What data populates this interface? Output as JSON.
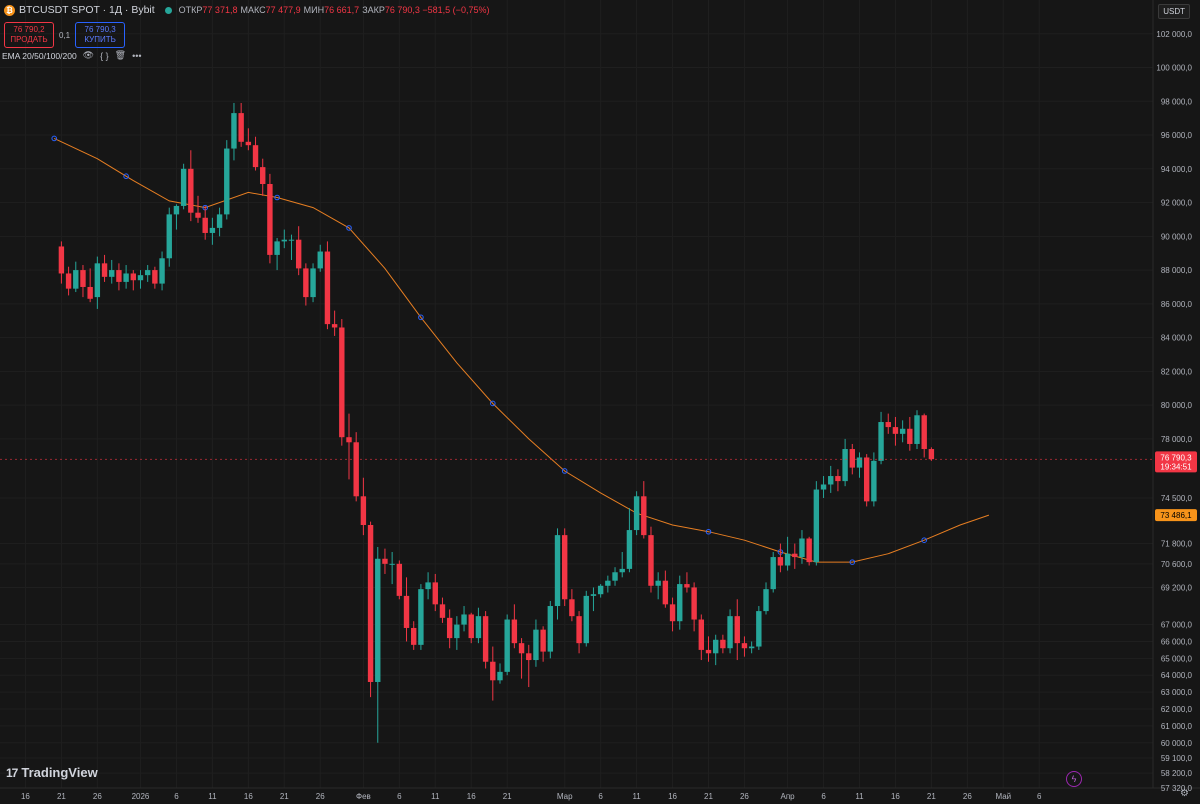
{
  "header": {
    "coin_glyph": "₿",
    "symbol": "BTCUSDT SPOT · 1Д · Bybit",
    "open_label": "ОТКР",
    "open_value": "77 371,8",
    "high_label": "МАКС",
    "high_value": "77 477,9",
    "low_label": "МИН",
    "low_value": "76 661,7",
    "close_label": "ЗАКР",
    "close_value": "76 790,3 −581,5 (−0,75%)"
  },
  "trade": {
    "sell_price": "76 790,2",
    "sell_label": "ПРОДАТЬ",
    "qty": "0,1",
    "buy_price": "76 790,3",
    "buy_label": "КУПИТЬ"
  },
  "indicator": {
    "label": "EMA 20/50/100/200",
    "eye_icon": "👁",
    "code_icon": "{ }",
    "trash_icon": "🗑",
    "more_icon": "•••"
  },
  "currency": "USDT",
  "brand": "TradingView",
  "brand_mark": "17",
  "colors": {
    "bg": "#161616",
    "up": "#26a69a",
    "down": "#f23645",
    "ema": "#e67e22",
    "ema_marker": "#2962ff",
    "price_tag": "#f23645",
    "ema_tag": "#f7931a"
  },
  "chart_data": {
    "type": "candlestick",
    "ylim": [
      57320,
      104000
    ],
    "y_ticks": [
      {
        "v": 102000,
        "t": "102 000,0"
      },
      {
        "v": 100000,
        "t": "100 000,0"
      },
      {
        "v": 98000,
        "t": "98 000,0"
      },
      {
        "v": 96000,
        "t": "96 000,0"
      },
      {
        "v": 94000,
        "t": "94 000,0"
      },
      {
        "v": 92000,
        "t": "92 000,0"
      },
      {
        "v": 90000,
        "t": "90 000,0"
      },
      {
        "v": 88000,
        "t": "88 000,0"
      },
      {
        "v": 86000,
        "t": "86 000,0"
      },
      {
        "v": 84000,
        "t": "84 000,0"
      },
      {
        "v": 82000,
        "t": "82 000,0"
      },
      {
        "v": 80000,
        "t": "80 000,0"
      },
      {
        "v": 78000,
        "t": "78 000,0"
      },
      {
        "v": 74500,
        "t": "74 500,0"
      },
      {
        "v": 71800,
        "t": "71 800,0"
      },
      {
        "v": 70600,
        "t": "70 600,0"
      },
      {
        "v": 69200,
        "t": "69 200,0"
      },
      {
        "v": 67000,
        "t": "67 000,0"
      },
      {
        "v": 66000,
        "t": "66 000,0"
      },
      {
        "v": 65000,
        "t": "65 000,0"
      },
      {
        "v": 64000,
        "t": "64 000,0"
      },
      {
        "v": 63000,
        "t": "63 000,0"
      },
      {
        "v": 62000,
        "t": "62 000,0"
      },
      {
        "v": 61000,
        "t": "61 000,0"
      },
      {
        "v": 60000,
        "t": "60 000,0"
      },
      {
        "v": 59100,
        "t": "59 100,0"
      },
      {
        "v": 58200,
        "t": "58 200,0"
      },
      {
        "v": 57320,
        "t": "57 320,0"
      }
    ],
    "x_ticks": [
      {
        "i": -5,
        "t": "16"
      },
      {
        "i": 0,
        "t": "21"
      },
      {
        "i": 5,
        "t": "26"
      },
      {
        "i": 11,
        "t": "2026"
      },
      {
        "i": 16,
        "t": "6"
      },
      {
        "i": 21,
        "t": "11"
      },
      {
        "i": 26,
        "t": "16"
      },
      {
        "i": 31,
        "t": "21"
      },
      {
        "i": 36,
        "t": "26"
      },
      {
        "i": 42,
        "t": "Фев"
      },
      {
        "i": 47,
        "t": "6"
      },
      {
        "i": 52,
        "t": "11"
      },
      {
        "i": 57,
        "t": "16"
      },
      {
        "i": 62,
        "t": "21"
      },
      {
        "i": 70,
        "t": "Мар"
      },
      {
        "i": 75,
        "t": "6"
      },
      {
        "i": 80,
        "t": "11"
      },
      {
        "i": 85,
        "t": "16"
      },
      {
        "i": 90,
        "t": "21"
      },
      {
        "i": 95,
        "t": "26"
      },
      {
        "i": 101,
        "t": "Апр"
      },
      {
        "i": 106,
        "t": "6"
      },
      {
        "i": 111,
        "t": "11"
      },
      {
        "i": 116,
        "t": "16"
      },
      {
        "i": 121,
        "t": "21"
      },
      {
        "i": 126,
        "t": "26"
      },
      {
        "i": 131,
        "t": "Май"
      },
      {
        "i": 136,
        "t": "6"
      }
    ],
    "last_price": {
      "value": 76790.3,
      "label": "76 790,3",
      "timer": "19:34:51"
    },
    "ema_tag": {
      "value": 73486.1,
      "label": "73 486,1"
    },
    "ema": [
      {
        "i": -1,
        "v": 95800
      },
      {
        "i": 5,
        "v": 94600
      },
      {
        "i": 10,
        "v": 93300
      },
      {
        "i": 15,
        "v": 92100
      },
      {
        "i": 20,
        "v": 91700
      },
      {
        "i": 26,
        "v": 92600
      },
      {
        "i": 30,
        "v": 92300
      },
      {
        "i": 35,
        "v": 91700
      },
      {
        "i": 40,
        "v": 90500
      },
      {
        "i": 45,
        "v": 88100
      },
      {
        "i": 50,
        "v": 85200
      },
      {
        "i": 55,
        "v": 82500
      },
      {
        "i": 60,
        "v": 80100
      },
      {
        "i": 65,
        "v": 78000
      },
      {
        "i": 70,
        "v": 76100
      },
      {
        "i": 75,
        "v": 74800
      },
      {
        "i": 80,
        "v": 73600
      },
      {
        "i": 85,
        "v": 72900
      },
      {
        "i": 90,
        "v": 72500
      },
      {
        "i": 95,
        "v": 72000
      },
      {
        "i": 100,
        "v": 71300
      },
      {
        "i": 105,
        "v": 70700
      },
      {
        "i": 110,
        "v": 70700
      },
      {
        "i": 115,
        "v": 71200
      },
      {
        "i": 120,
        "v": 72000
      },
      {
        "i": 125,
        "v": 72900
      },
      {
        "i": 129,
        "v": 73486
      }
    ],
    "ema_markers": [
      -1,
      9,
      20,
      30,
      40,
      50,
      60,
      70,
      80,
      90,
      100,
      110,
      120
    ],
    "candles": [
      [
        89400,
        89700,
        87200,
        87800
      ],
      [
        87800,
        88200,
        86500,
        86900
      ],
      [
        86900,
        88500,
        86700,
        88000
      ],
      [
        88000,
        88300,
        86400,
        87000
      ],
      [
        87000,
        88100,
        86100,
        86300
      ],
      [
        86400,
        88800,
        85700,
        88400
      ],
      [
        88400,
        88900,
        87300,
        87600
      ],
      [
        87600,
        88600,
        87200,
        88000
      ],
      [
        88000,
        88400,
        86800,
        87300
      ],
      [
        87300,
        88300,
        86900,
        87800
      ],
      [
        87800,
        88000,
        86800,
        87400
      ],
      [
        87400,
        88000,
        86900,
        87700
      ],
      [
        87700,
        88300,
        87300,
        88000
      ],
      [
        88000,
        88200,
        86900,
        87200
      ],
      [
        87200,
        89100,
        86800,
        88700
      ],
      [
        88700,
        91700,
        88200,
        91300
      ],
      [
        91300,
        91900,
        90400,
        91800
      ],
      [
        91800,
        94300,
        91600,
        94000
      ],
      [
        94000,
        95100,
        90900,
        91400
      ],
      [
        91400,
        92400,
        90800,
        91100
      ],
      [
        91100,
        91800,
        89800,
        90200
      ],
      [
        90200,
        91100,
        89500,
        90500
      ],
      [
        90500,
        91700,
        90000,
        91300
      ],
      [
        91300,
        95700,
        91000,
        95200
      ],
      [
        95200,
        97900,
        94500,
        97300
      ],
      [
        97300,
        97900,
        95300,
        95600
      ],
      [
        95600,
        96400,
        95100,
        95400
      ],
      [
        95400,
        95900,
        93900,
        94100
      ],
      [
        94100,
        94600,
        92400,
        93100
      ],
      [
        93100,
        93700,
        88400,
        88900
      ],
      [
        88900,
        89900,
        88000,
        89700
      ],
      [
        89700,
        90400,
        89300,
        89800
      ],
      [
        89800,
        90100,
        88600,
        89800
      ],
      [
        89800,
        90600,
        87700,
        88100
      ],
      [
        88100,
        88400,
        85900,
        86400
      ],
      [
        86400,
        88400,
        86100,
        88100
      ],
      [
        88100,
        89500,
        87900,
        89100
      ],
      [
        89100,
        89700,
        84500,
        84800
      ],
      [
        84800,
        85600,
        84100,
        84600
      ],
      [
        84600,
        85100,
        77600,
        78100
      ],
      [
        78100,
        79500,
        75600,
        77800
      ],
      [
        77800,
        78400,
        74300,
        74600
      ],
      [
        74600,
        75700,
        72300,
        72900
      ],
      [
        72900,
        73100,
        62700,
        63600
      ],
      [
        63600,
        71600,
        60000,
        70900
      ],
      [
        70900,
        71500,
        70000,
        70600
      ],
      [
        70600,
        71300,
        69400,
        70600
      ],
      [
        70600,
        70800,
        68500,
        68700
      ],
      [
        68700,
        69800,
        66000,
        66800
      ],
      [
        66800,
        67200,
        65500,
        65800
      ],
      [
        65800,
        69400,
        65500,
        69100
      ],
      [
        69100,
        70100,
        68500,
        69500
      ],
      [
        69500,
        70000,
        67800,
        68200
      ],
      [
        68200,
        68600,
        67100,
        67400
      ],
      [
        67400,
        67900,
        65600,
        66200
      ],
      [
        66200,
        67500,
        65500,
        67000
      ],
      [
        67000,
        68100,
        66600,
        67600
      ],
      [
        67600,
        67700,
        65900,
        66200
      ],
      [
        66200,
        68000,
        65900,
        67500
      ],
      [
        67500,
        67800,
        64400,
        64800
      ],
      [
        64800,
        65700,
        62500,
        63700
      ],
      [
        63700,
        64700,
        63500,
        64200
      ],
      [
        64200,
        67600,
        64000,
        67300
      ],
      [
        67300,
        68200,
        65600,
        65900
      ],
      [
        65900,
        66200,
        63800,
        65300
      ],
      [
        65300,
        65800,
        63300,
        64900
      ],
      [
        64900,
        67300,
        64500,
        66700
      ],
      [
        66700,
        66900,
        64800,
        65400
      ],
      [
        65400,
        68400,
        65000,
        68100
      ],
      [
        68100,
        72700,
        67300,
        72300
      ],
      [
        72300,
        72700,
        68100,
        68500
      ],
      [
        68500,
        69100,
        67200,
        67500
      ],
      [
        67500,
        67800,
        65300,
        65900
      ],
      [
        65900,
        69000,
        65700,
        68700
      ],
      [
        68700,
        69200,
        67800,
        68800
      ],
      [
        68800,
        69400,
        68600,
        69300
      ],
      [
        69300,
        69900,
        68900,
        69600
      ],
      [
        69600,
        70400,
        69300,
        70100
      ],
      [
        70100,
        71300,
        69800,
        70300
      ],
      [
        70300,
        73900,
        70100,
        72600
      ],
      [
        72600,
        74900,
        72300,
        74600
      ],
      [
        74600,
        75500,
        72100,
        72300
      ],
      [
        72300,
        72800,
        68900,
        69300
      ],
      [
        69300,
        70100,
        68500,
        69600
      ],
      [
        69600,
        70200,
        68000,
        68200
      ],
      [
        68200,
        68600,
        66600,
        67200
      ],
      [
        67200,
        69900,
        66700,
        69400
      ],
      [
        69400,
        70100,
        68900,
        69200
      ],
      [
        69200,
        69500,
        66600,
        67300
      ],
      [
        67300,
        67600,
        64900,
        65500
      ],
      [
        65500,
        66300,
        64800,
        65300
      ],
      [
        65300,
        66400,
        64600,
        66100
      ],
      [
        66100,
        66400,
        65300,
        65600
      ],
      [
        65600,
        67900,
        65300,
        67500
      ],
      [
        67500,
        68500,
        64900,
        65900
      ],
      [
        65900,
        66300,
        65100,
        65600
      ],
      [
        65600,
        66000,
        65300,
        65700
      ],
      [
        65700,
        68100,
        65500,
        67800
      ],
      [
        67800,
        69500,
        67600,
        69100
      ],
      [
        69100,
        71300,
        68900,
        71000
      ],
      [
        71000,
        71800,
        70100,
        70500
      ],
      [
        70500,
        72200,
        70200,
        71200
      ],
      [
        71200,
        71800,
        70300,
        71000
      ],
      [
        71000,
        72600,
        70600,
        72100
      ],
      [
        72100,
        72200,
        70500,
        70700
      ],
      [
        70700,
        75500,
        70500,
        75000
      ],
      [
        75000,
        75800,
        74500,
        75300
      ],
      [
        75300,
        76400,
        74800,
        75800
      ],
      [
        75800,
        76200,
        74900,
        75500
      ],
      [
        75500,
        78000,
        75200,
        77400
      ],
      [
        77400,
        77700,
        75900,
        76300
      ],
      [
        76300,
        77200,
        75700,
        76900
      ],
      [
        76900,
        77100,
        74000,
        74300
      ],
      [
        74300,
        77200,
        74000,
        76700
      ],
      [
        76700,
        79600,
        76500,
        79000
      ],
      [
        79000,
        79500,
        78300,
        78700
      ],
      [
        78700,
        79300,
        77600,
        78300
      ],
      [
        78300,
        79100,
        77800,
        78600
      ],
      [
        78600,
        79300,
        77300,
        77700
      ],
      [
        77700,
        79700,
        77400,
        79400
      ],
      [
        79400,
        79500,
        76900,
        77400
      ],
      [
        77400,
        77500,
        76700,
        76800
      ]
    ]
  }
}
